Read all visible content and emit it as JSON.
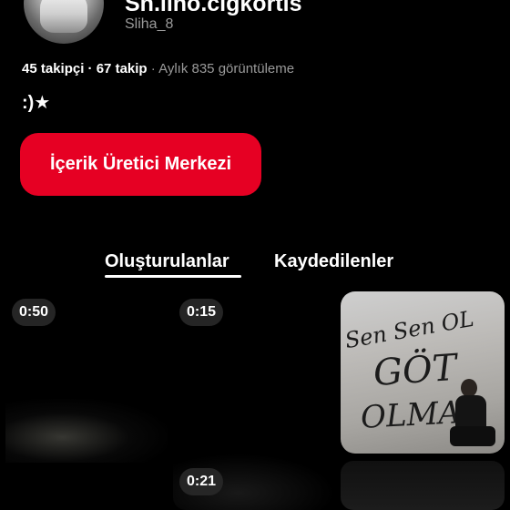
{
  "profile": {
    "display_name": "Sn.lıno.cıgkortis",
    "username": "Sliha_8",
    "followers": "45 takipçi",
    "separator": " · ",
    "following": "67 takip",
    "monthly_views": " · Aylık 835 görüntüleme",
    "bio": ":)★"
  },
  "actions": {
    "creator_hub_label": "İçerik Üretici Merkezi"
  },
  "tabs": [
    {
      "label": "Oluşturulanlar",
      "selected": true
    },
    {
      "label": "Kaydedilenler",
      "selected": false
    }
  ],
  "pins": [
    {
      "duration": "0:50",
      "type": "video"
    },
    {
      "duration": "0:15",
      "type": "video"
    },
    {
      "type": "image",
      "graffiti": [
        "Sen Sen OL",
        "GÖT",
        "OLMA"
      ]
    },
    {
      "duration": "0:21",
      "type": "video"
    }
  ],
  "colors": {
    "background": "#000000",
    "accent": "#e60023",
    "muted_text": "#9a9a9a"
  }
}
